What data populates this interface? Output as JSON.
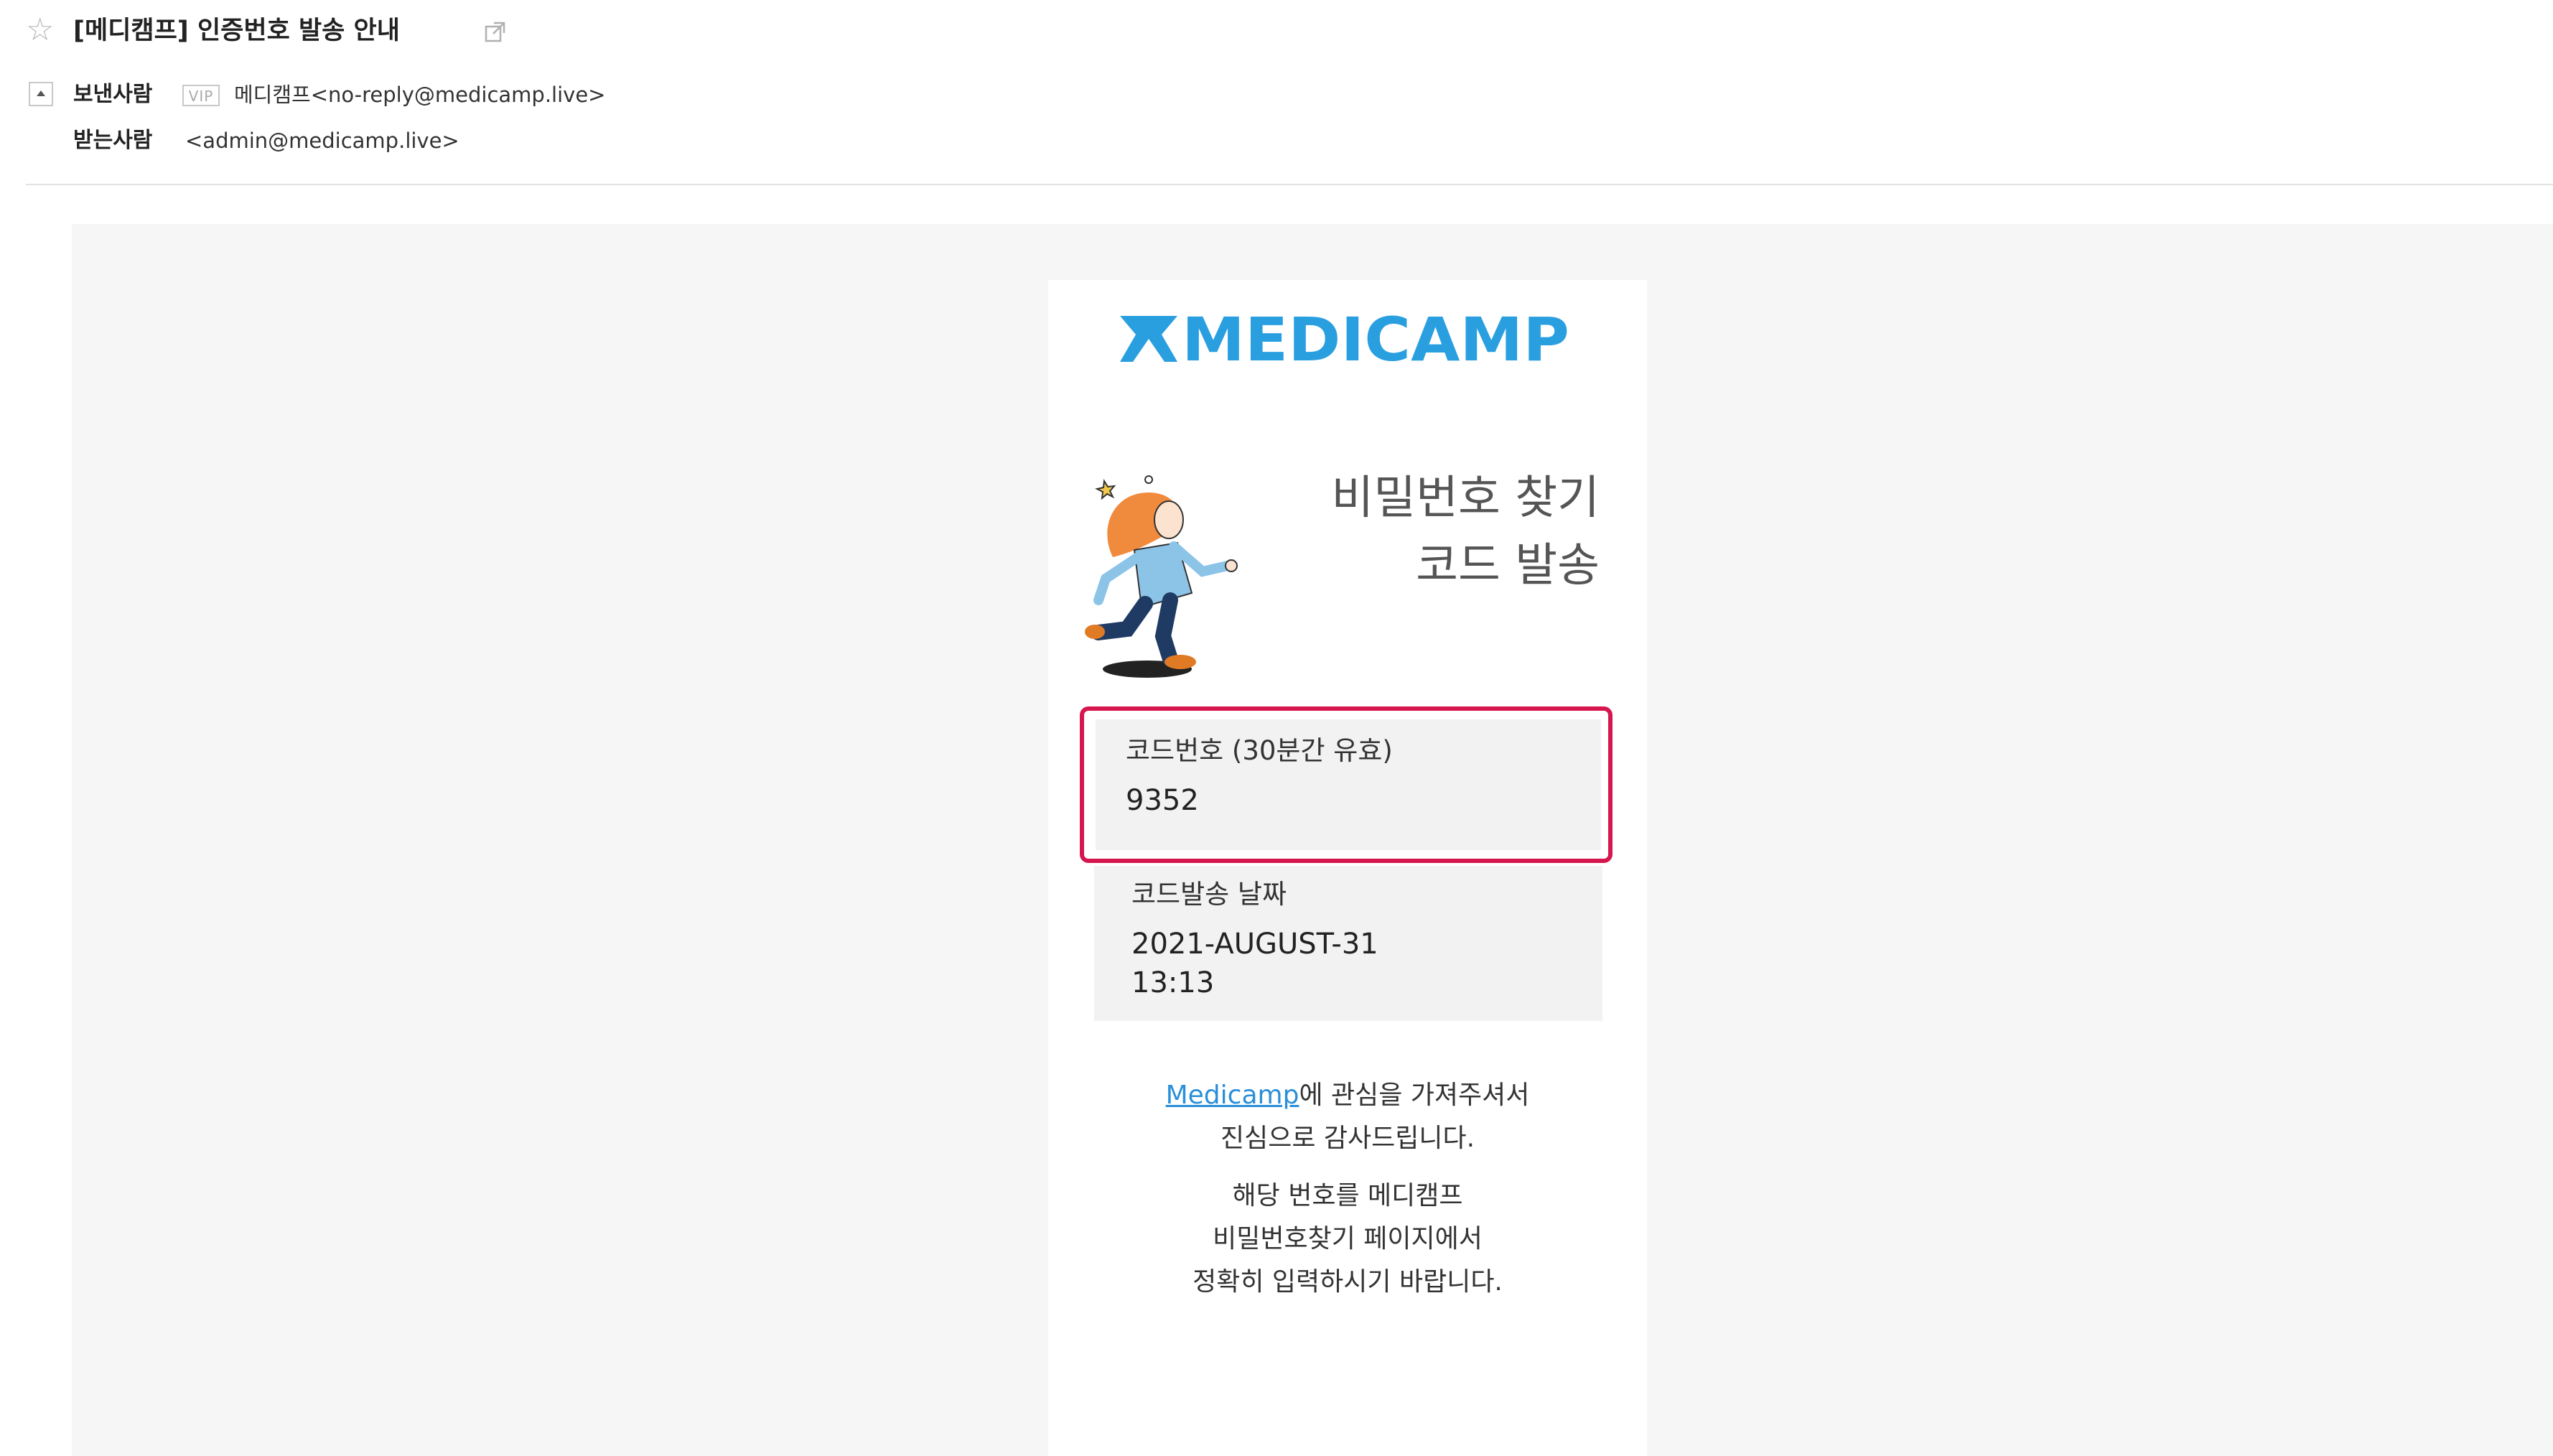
{
  "email": {
    "subject": "[메디캠프] 인증번호 발송 안내",
    "sender_label": "보낸사람",
    "vip_badge": "VIP",
    "sender_value": "메디캠프<no-reply@medicamp.live>",
    "recipient_label": "받는사람",
    "recipient_value": "<admin@medicamp.live>"
  },
  "body": {
    "logo_text": "MEDICAMP",
    "title_line1": "비밀번호 찾기",
    "title_line2": "코드 발송",
    "code_label": "코드번호 (30분간 유효)",
    "code_value": "9352",
    "date_label": "코드발송 날짜",
    "date_line1": "2021-AUGUST-31",
    "date_line2": "13:13",
    "thanks_link": "Medicamp",
    "thanks_line1_rest": "에 관심을 가져주셔서",
    "thanks_line2": "진심으로 감사드립니다.",
    "instruction_line1": "해당 번호를 메디캠프",
    "instruction_line2": "비밀번호찾기 페이지에서",
    "instruction_line3": "정확히 입력하시기 바랍니다."
  },
  "colors": {
    "logo_blue": "#2a9fe0",
    "highlight_border": "#d6164e",
    "link": "#2a8fd8",
    "box_bg": "#f2f2f2"
  },
  "icons": [
    "star-icon",
    "external-link-icon",
    "collapse-toggle-icon",
    "medicamp-logo-icon",
    "running-girl-illustration"
  ]
}
